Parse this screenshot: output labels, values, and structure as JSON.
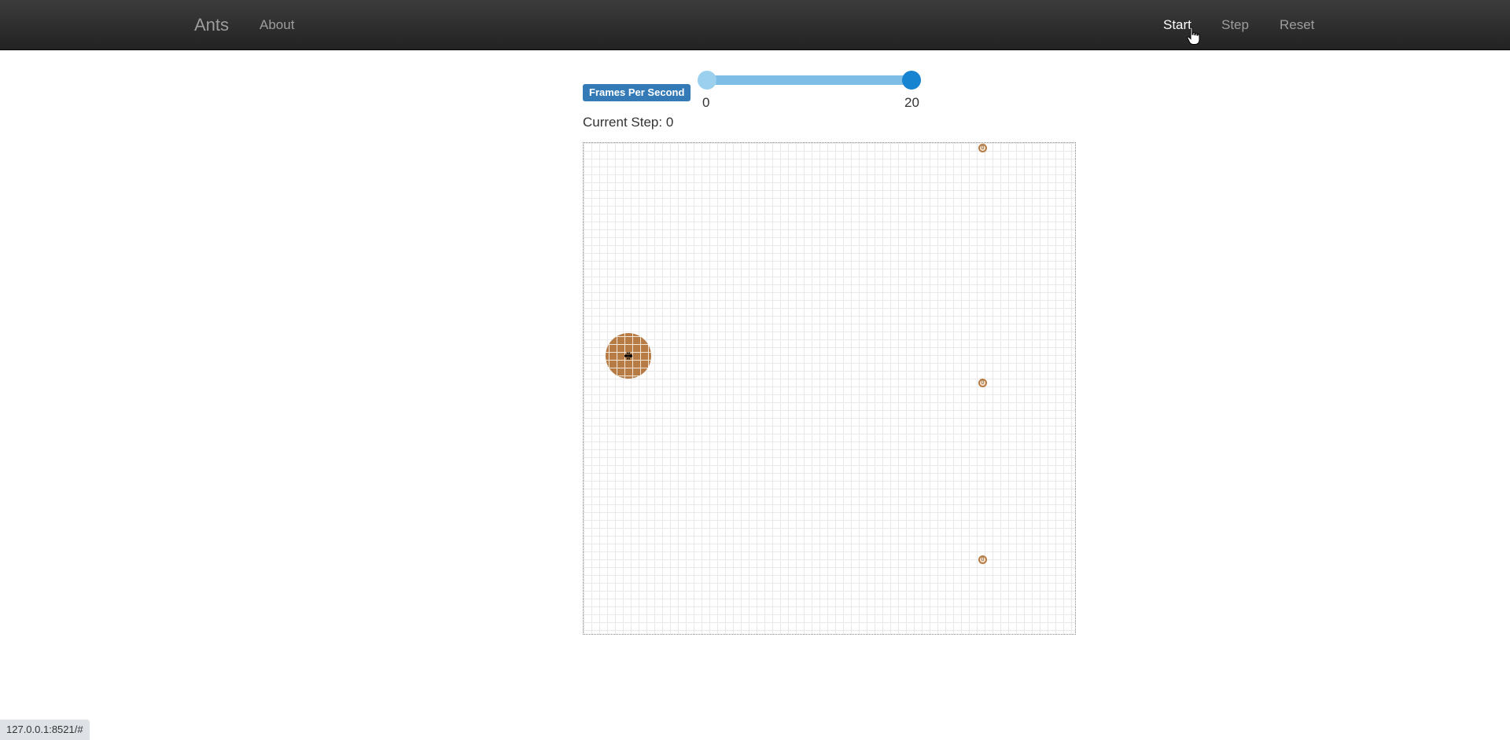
{
  "navbar": {
    "brand": "Ants",
    "links": {
      "about": "About",
      "start": "Start",
      "step": "Step",
      "reset": "Reset"
    },
    "active_link": "Start"
  },
  "controls": {
    "fps_label": "Frames Per Second",
    "fps_slider": {
      "min_label": "0",
      "max_label": "20",
      "low_value": 0,
      "high_value": 20,
      "track_color": "#7dbde6",
      "handle_color": "#1784d1"
    },
    "current_step_label": "Current Step: 0"
  },
  "simulation": {
    "food_sources": [
      "0",
      "0",
      "0"
    ],
    "nest_color": "#b77c45"
  },
  "status_bar": {
    "url": "127.0.0.1:8521/#"
  },
  "colors": {
    "label_badge": "#337ab7",
    "navbar": "#222222"
  },
  "icons": {
    "cursor": "hand-pointer-icon",
    "ant": "ant-icon"
  }
}
